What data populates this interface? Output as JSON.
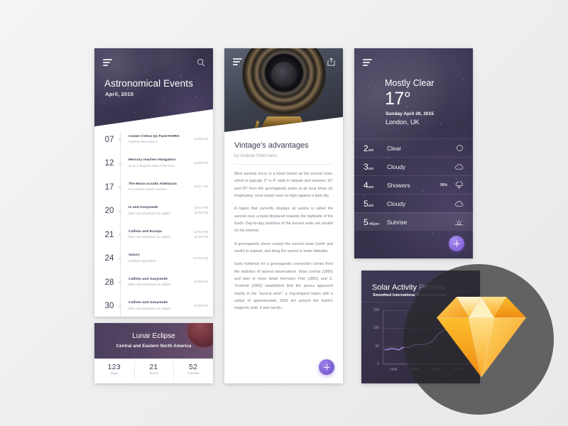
{
  "canvas": {
    "bg": "#f1f1f1",
    "accent": "#7e62d6",
    "dark": "#3b3550"
  },
  "events_panel": {
    "title": "Astronomical Events",
    "subtitle": "April, 2015",
    "menu_icon": "hamburger-icon",
    "search_icon": "search-icon",
    "events": [
      {
        "day": "07",
        "name": "Comet C/2014 Q1 PanSTARRS",
        "desc": "reaches binocular X",
        "times": [
          "12:53 AM"
        ]
      },
      {
        "day": "12",
        "name": "Mercury reaches  elongation",
        "desc": "at 21.2 degrees east of the Sun",
        "times": [
          "04:00 PM"
        ]
      },
      {
        "day": "17",
        "name": "The Moon occults Aldebaran",
        "desc": "for northern North America",
        "times": [
          "02:57 AM"
        ]
      },
      {
        "day": "20",
        "name": "Io and Ganymede",
        "desc": "both cast shadows on Jupiter",
        "times": [
          "10:04 PM",
          "10:33 PM"
        ]
      },
      {
        "day": "21",
        "name": "Callisto and Europa",
        "desc": "both cast shadows on Jupiter",
        "times": [
          "10:04 PM",
          "10:33 PM"
        ]
      },
      {
        "day": "24",
        "name": "Saturn",
        "desc": "reaches opposition",
        "times": [
          "~12:53 AM"
        ]
      },
      {
        "day": "28",
        "name": "Callisto and Ganymede",
        "desc": "both cast shadows on Jupiter",
        "times": [
          "01:56 PM"
        ]
      },
      {
        "day": "30",
        "name": "Callisto and Ganymede",
        "desc": "both cast shadows on Jupiter",
        "times": [
          "01:56 PM"
        ]
      }
    ]
  },
  "eclipse_panel": {
    "title": "Lunar Eclipse",
    "subtitle": "Central and Eastern North America",
    "moon_icon": "blood-moon-icon",
    "countdown": [
      {
        "value": "123",
        "label": "days"
      },
      {
        "value": "21",
        "label": "hours"
      },
      {
        "value": "52",
        "label": "minutes"
      }
    ]
  },
  "article_panel": {
    "menu_icon": "hamburger-icon",
    "share_icon": "share-icon",
    "photo_alt": "telescope-lens-photo",
    "title": "Vintage's advantages",
    "author": "by Andrew Stelhmann",
    "paragraphs": [
      "Most auroras occur in a band known as the auroral zone, which is typically 3° to 6° wide in latitude and between 10° and 20° from the geomagnetic poles at all local times (or longitudes), most clearly seen at night against a dark sky.",
      "A region that currently displays an aurora is called the auroral oval, a band displaced towards the nightside of the Earth. Day-to-day positions of the auroral ovals are posted on the internet.",
      "A geomagnetic storm causes the auroral ovals (north and south) to expand, and bring the aurora to lower latitudes.",
      "Early evidence for a geomagnetic connection comes from the statistics of auroral observations. Elias Loomis (1860) and later in more detail Hermann Fritz (1881) and S. Tromholt (1882) established that the aurora appeared mainly in the \"auroral zone\", a ring-shaped region with a radius of approximately 2500 km around the Earth's magnetic pole. It was hardly..."
    ],
    "fab_icon": "plus-icon"
  },
  "weather_panel": {
    "menu_icon": "hamburger-icon",
    "condition": "Mostly Clear",
    "temperature": "17°",
    "date": "Sunday April 26, 2015",
    "location": "London, UK",
    "fab_icon": "plus-icon",
    "forecast": [
      {
        "hour": "2",
        "meridiem": "am",
        "label": "Clear",
        "chance": "",
        "icon": "sun-circle-icon",
        "active": false
      },
      {
        "hour": "3",
        "meridiem": "am",
        "label": "Cloudy",
        "chance": "",
        "icon": "cloud-icon",
        "active": false
      },
      {
        "hour": "4",
        "meridiem": "am",
        "label": "Showers",
        "chance": "50%",
        "icon": "rain-cloud-icon",
        "active": false
      },
      {
        "hour": "5",
        "meridiem": "am",
        "label": "Cloudy",
        "chance": "",
        "icon": "cloud-icon",
        "active": false
      },
      {
        "hour": "5",
        "meridiem": ":46pm",
        "label": "Sunrise",
        "chance": "",
        "icon": "sunrise-icon",
        "active": true
      }
    ]
  },
  "solar_panel": {
    "title_highlight": "Solar Activity",
    "title_dim": " Proxies",
    "subtitle_highlight": "Smoothed Internationa",
    "subtitle_dim": "l Sunspot Number"
  },
  "chart_data": {
    "type": "line",
    "title": "Solar Activity Proxies",
    "subtitle": "Smoothed International Sunspot Number",
    "xlabel": "",
    "ylabel": "",
    "ylim": [
      0,
      150
    ],
    "yticks": [
      0,
      50,
      100,
      150
    ],
    "categories": [
      "JAN",
      "FEB",
      "MAR",
      "APR"
    ],
    "grid": true,
    "legend": "none",
    "line_color": "#a98fe0",
    "series": [
      {
        "name": "Smoothed International Sunspot Number",
        "x": [
          0,
          0.12,
          0.25,
          0.38,
          0.5,
          0.62,
          0.75,
          0.88,
          1.0,
          1.15,
          1.3,
          1.5,
          1.7,
          1.85,
          2.0,
          2.2,
          2.4,
          2.6,
          2.8,
          3.0
        ],
        "values": [
          40,
          41,
          44,
          42,
          40,
          45,
          48,
          46,
          52,
          55,
          54,
          56,
          62,
          75,
          88,
          96,
          99,
          100,
          92,
          95
        ]
      }
    ]
  },
  "overlay": {
    "logo": "sketch-diamond-logo"
  }
}
